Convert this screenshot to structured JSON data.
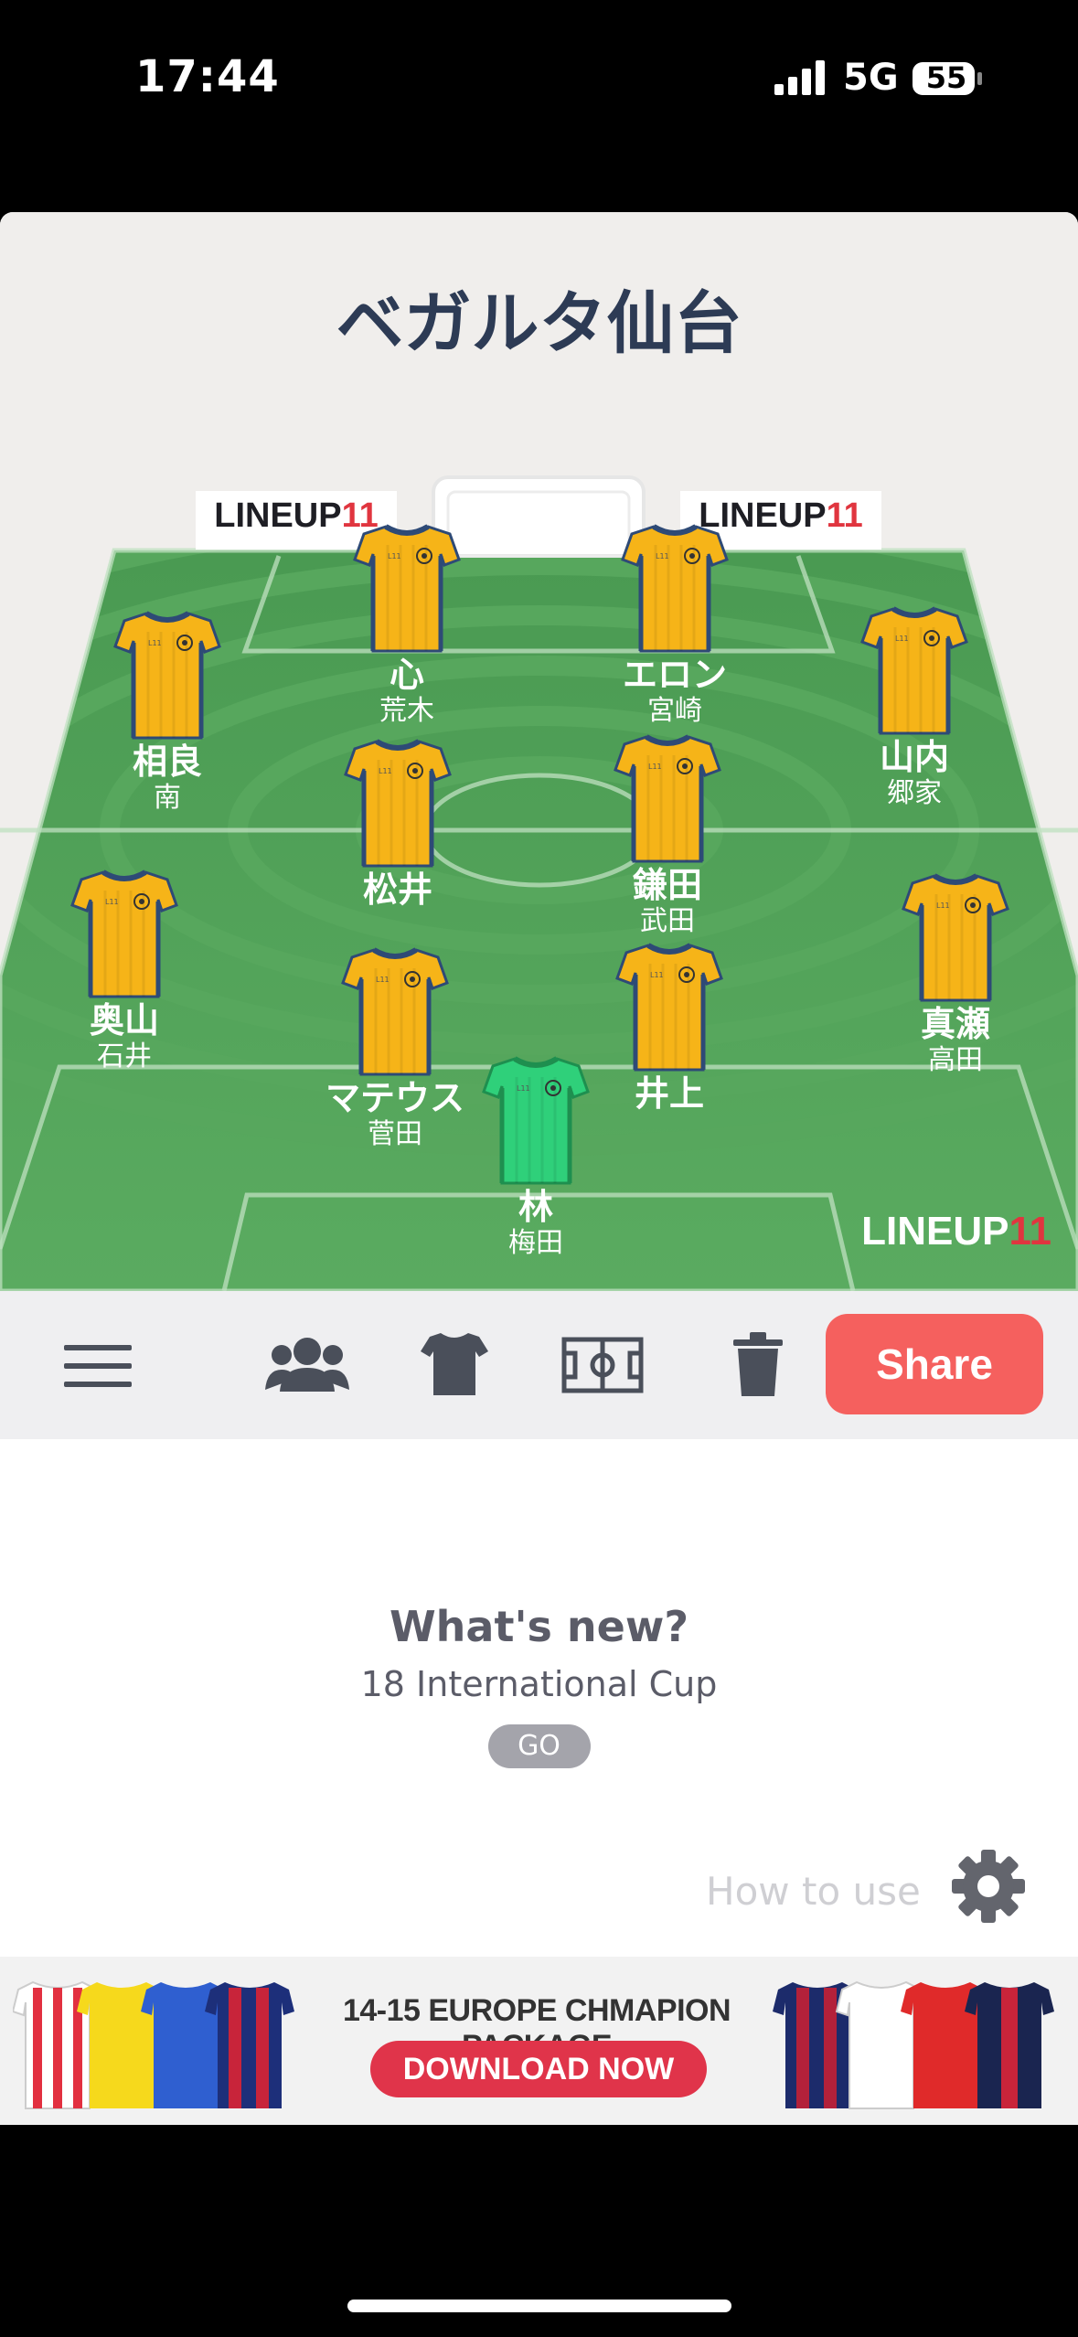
{
  "status_bar": {
    "time": "17:44",
    "network": "5G",
    "battery": "55"
  },
  "team": {
    "name": "ベガルタ仙台"
  },
  "brand": {
    "logo_text": "LINEUP",
    "logo_num": "11"
  },
  "players": [
    {
      "name": "心",
      "number": "荒木",
      "kit": "outfield"
    },
    {
      "name": "エロン",
      "number": "宮崎",
      "kit": "outfield"
    },
    {
      "name": "相良",
      "number": "南",
      "kit": "outfield"
    },
    {
      "name": "山内",
      "number": "郷家",
      "kit": "outfield"
    },
    {
      "name": "松井",
      "number": "",
      "kit": "outfield"
    },
    {
      "name": "鎌田",
      "number": "武田",
      "kit": "outfield"
    },
    {
      "name": "奥山",
      "number": "石井",
      "kit": "outfield"
    },
    {
      "name": "真瀬",
      "number": "高田",
      "kit": "outfield"
    },
    {
      "name": "マテウス",
      "number": "菅田",
      "kit": "outfield"
    },
    {
      "name": "井上",
      "number": "",
      "kit": "outfield"
    },
    {
      "name": "林",
      "number": "梅田",
      "kit": "goalkeeper"
    }
  ],
  "toolbar": {
    "menu_icon": "menu-icon",
    "players_icon": "people-icon",
    "kit_icon": "shirt-icon",
    "pitch_icon": "pitch-icon",
    "delete_icon": "trash-icon",
    "share_label": "Share"
  },
  "whats_new": {
    "title": "What's new?",
    "subtitle": "18 International Cup",
    "go_label": "GO"
  },
  "how_to_use": {
    "label": "How to use",
    "icon": "gear-icon"
  },
  "ad": {
    "headline": "14-15 EUROPE CHMAPION PACKAGE",
    "cta": "DOWNLOAD NOW"
  },
  "colors": {
    "kit": "#f6b418",
    "kit_trim": "#2e4a76",
    "gk_kit": "#2fd07a",
    "pitch": "#4e9e56",
    "share": "#f5605e",
    "title": "#2d3b55"
  }
}
